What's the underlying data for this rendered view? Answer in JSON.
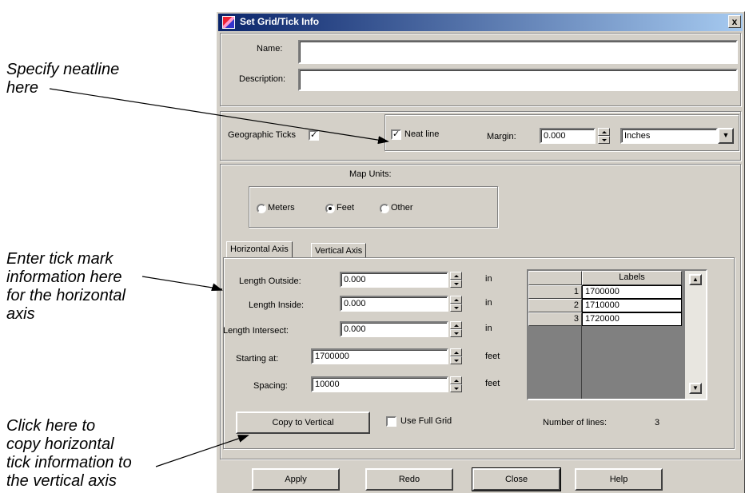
{
  "callouts": {
    "neatline": [
      "Specify neatline",
      "here"
    ],
    "tickmark": [
      "Enter tick mark",
      "information here",
      "for the horizontal",
      "axis"
    ],
    "copy": [
      "Click here to",
      "copy horizontal",
      "tick information to",
      "the vertical axis"
    ]
  },
  "window": {
    "title": "Set Grid/Tick Info",
    "close": "x"
  },
  "name_field": {
    "label": "Name:",
    "value": ""
  },
  "description_field": {
    "label": "Description:",
    "value": ""
  },
  "geographic_ticks": {
    "label": "Geographic Ticks",
    "checked": true
  },
  "neatline": {
    "label": "Neat line",
    "checked": true,
    "margin_label": "Margin:",
    "margin_value": "0.000",
    "units": "Inches"
  },
  "map_units": {
    "label": "Map Units:",
    "options": [
      "Meters",
      "Feet",
      "Other"
    ],
    "selected": "Feet"
  },
  "tabs": [
    "Horizontal Axis",
    "Vertical Axis"
  ],
  "axis": {
    "length_outside": {
      "label": "Length Outside:",
      "value": "0.000",
      "unit": "in"
    },
    "length_inside": {
      "label": "Length Inside:",
      "value": "0.000",
      "unit": "in"
    },
    "length_intersect": {
      "label": "Length Intersect:",
      "value": "0.000",
      "unit": "in"
    },
    "starting_at": {
      "label": "Starting at:",
      "value": "1700000",
      "unit": "feet"
    },
    "spacing": {
      "label": "Spacing:",
      "value": "10000",
      "unit": "feet"
    }
  },
  "labels_table": {
    "header": "Labels",
    "rows": [
      {
        "index": "1",
        "value": "1700000"
      },
      {
        "index": "2",
        "value": "1710000"
      },
      {
        "index": "3",
        "value": "1720000"
      }
    ]
  },
  "copy_button": "Copy to Vertical",
  "use_full_grid": {
    "label": "Use Full Grid",
    "checked": false
  },
  "number_of_lines": {
    "label": "Number of lines:",
    "value": "3"
  },
  "footer_buttons": [
    "Apply",
    "Redo",
    "Close",
    "Help"
  ]
}
